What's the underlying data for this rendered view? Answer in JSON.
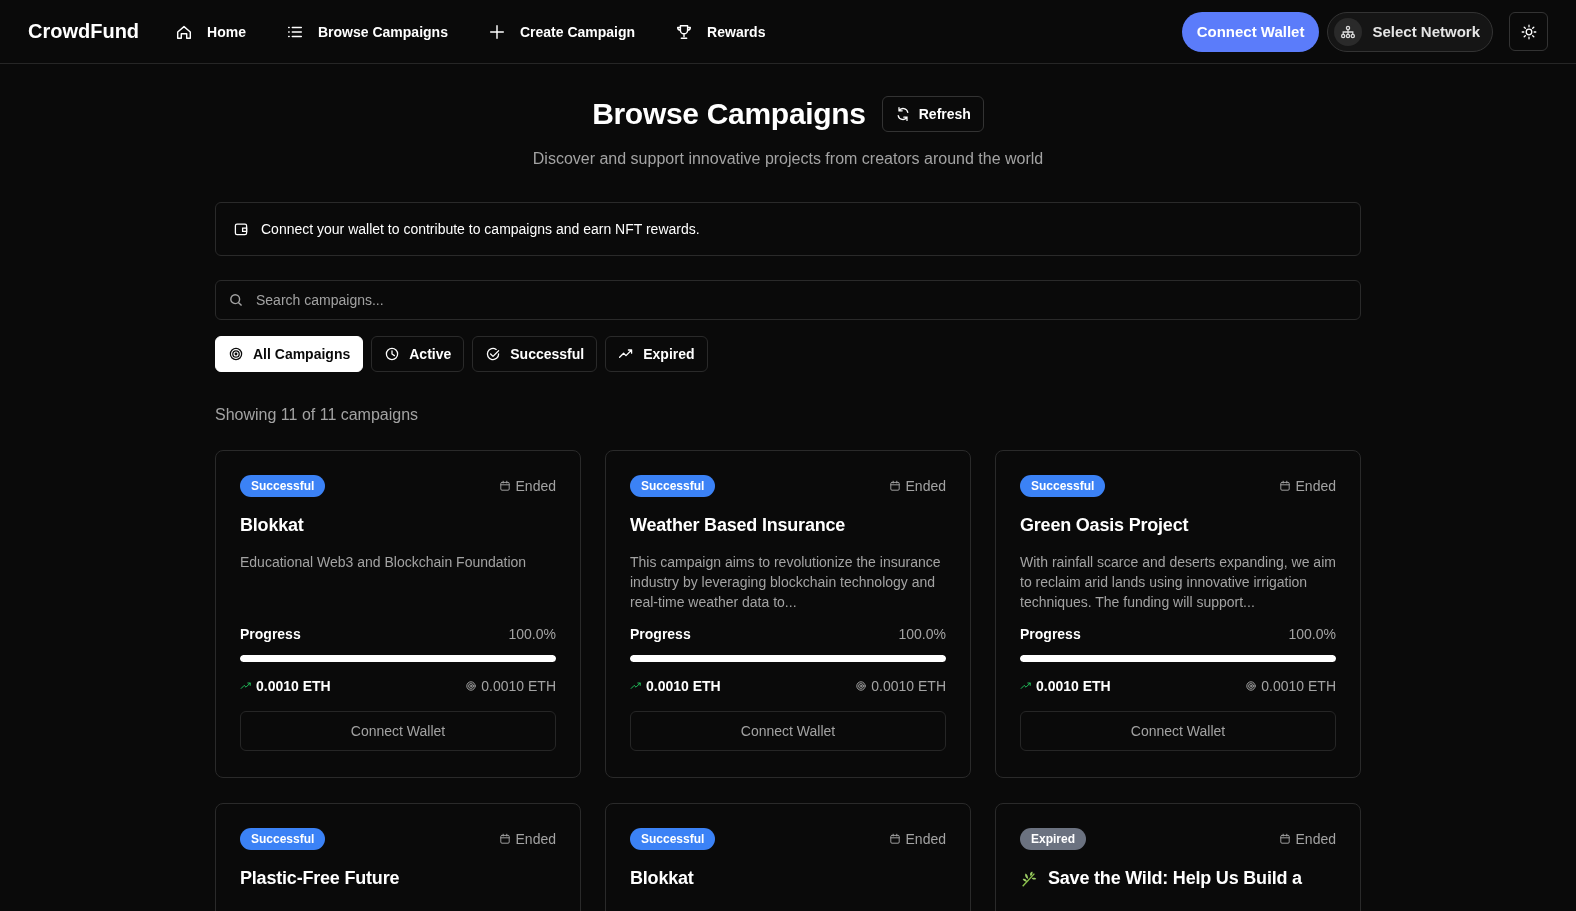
{
  "nav": {
    "brand": "CrowdFund",
    "items": [
      {
        "label": "Home"
      },
      {
        "label": "Browse Campaigns"
      },
      {
        "label": "Create Campaign"
      },
      {
        "label": "Rewards"
      }
    ],
    "connect": "Connect Wallet",
    "network": "Select Network"
  },
  "header": {
    "title": "Browse Campaigns",
    "refresh": "Refresh",
    "subtitle": "Discover and support innovative projects from creators around the world"
  },
  "notice": "Connect your wallet to contribute to campaigns and earn NFT rewards.",
  "search": {
    "placeholder": "Search campaigns..."
  },
  "filters": [
    {
      "label": "All Campaigns",
      "selected": true
    },
    {
      "label": "Active",
      "selected": false
    },
    {
      "label": "Successful",
      "selected": false
    },
    {
      "label": "Expired",
      "selected": false
    }
  ],
  "count": "Showing 11 of 11 campaigns",
  "campaigns": [
    {
      "status": "Successful",
      "kind": "successful",
      "ended": "Ended",
      "title": "Blokkat",
      "description": "Educational Web3 and Blockchain Foundation",
      "progress_label": "Progress",
      "percent": "100.0%",
      "level": 1,
      "raised": "0.0010 ETH",
      "goal": "0.0010 ETH",
      "action": "Connect Wallet"
    },
    {
      "status": "Successful",
      "kind": "successful",
      "ended": "Ended",
      "title": "Weather Based Insurance",
      "description": "This campaign aims to revolutionize the insurance industry by leveraging blockchain technology and real-time weather data to...",
      "progress_label": "Progress",
      "percent": "100.0%",
      "level": 1,
      "raised": "0.0010 ETH",
      "goal": "0.0010 ETH",
      "action": "Connect Wallet"
    },
    {
      "status": "Successful",
      "kind": "successful",
      "ended": "Ended",
      "title": "Green Oasis Project",
      "description": "With rainfall scarce and deserts expanding, we aim to reclaim arid lands using innovative irrigation techniques. The funding will support...",
      "progress_label": "Progress",
      "percent": "100.0%",
      "level": 1,
      "raised": "0.0010 ETH",
      "goal": "0.0010 ETH",
      "action": "Connect Wallet"
    },
    {
      "status": "Successful",
      "kind": "successful",
      "ended": "Ended",
      "title": "Plastic-Free Future"
    },
    {
      "status": "Successful",
      "kind": "successful",
      "ended": "Ended",
      "title": "Blokkat"
    },
    {
      "status": "Expired",
      "kind": "expired",
      "ended": "Ended",
      "title": "Save the Wild: Help Us Build a",
      "leaf": true
    }
  ]
}
